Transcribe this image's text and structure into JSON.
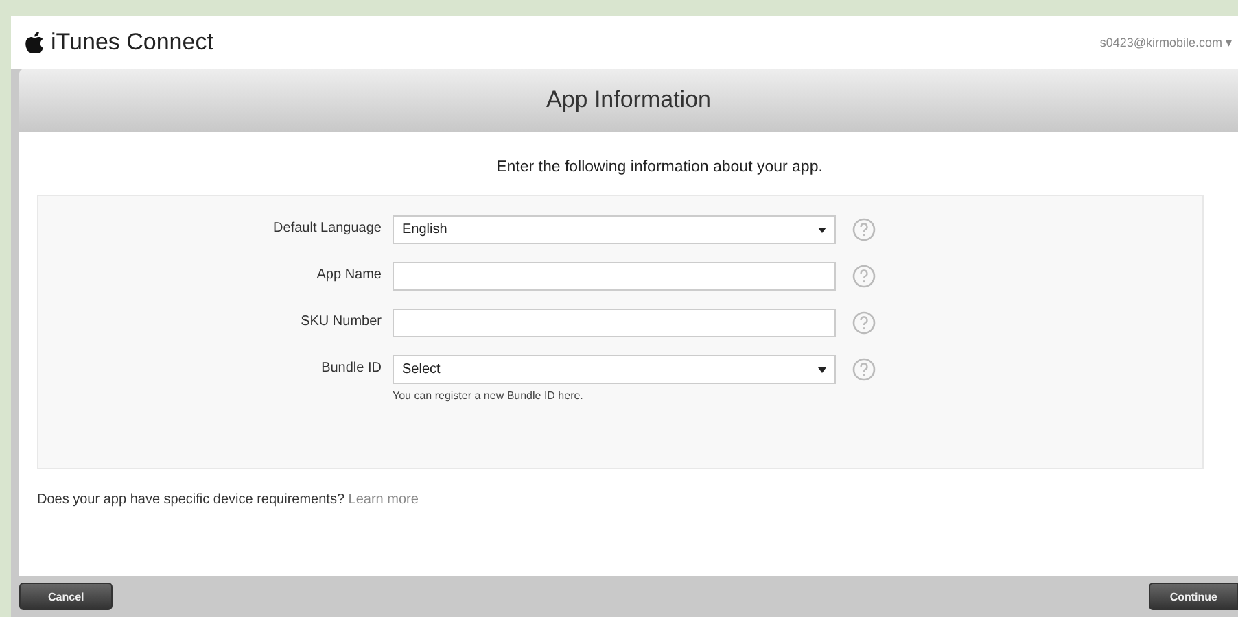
{
  "header": {
    "logo_text": "iTunes Connect",
    "account": "s0423@kirmobile.com",
    "account_caret": "▾"
  },
  "panel": {
    "title": "App Information",
    "intro": "Enter the following information about your app."
  },
  "fields": [
    {
      "kind": "select",
      "label": "Default Language",
      "value": "English"
    },
    {
      "kind": "text",
      "label": "App Name"
    },
    {
      "kind": "text",
      "label": "SKU Number"
    },
    {
      "kind": "select",
      "label": "Bundle ID",
      "value": "Select",
      "hint": "You can register a new Bundle ID here."
    }
  ],
  "device_note": {
    "text": "Does your app have specific device requirements?",
    "link": "Learn more"
  },
  "buttons": {
    "cancel": "Cancel",
    "continue": "Continue"
  }
}
